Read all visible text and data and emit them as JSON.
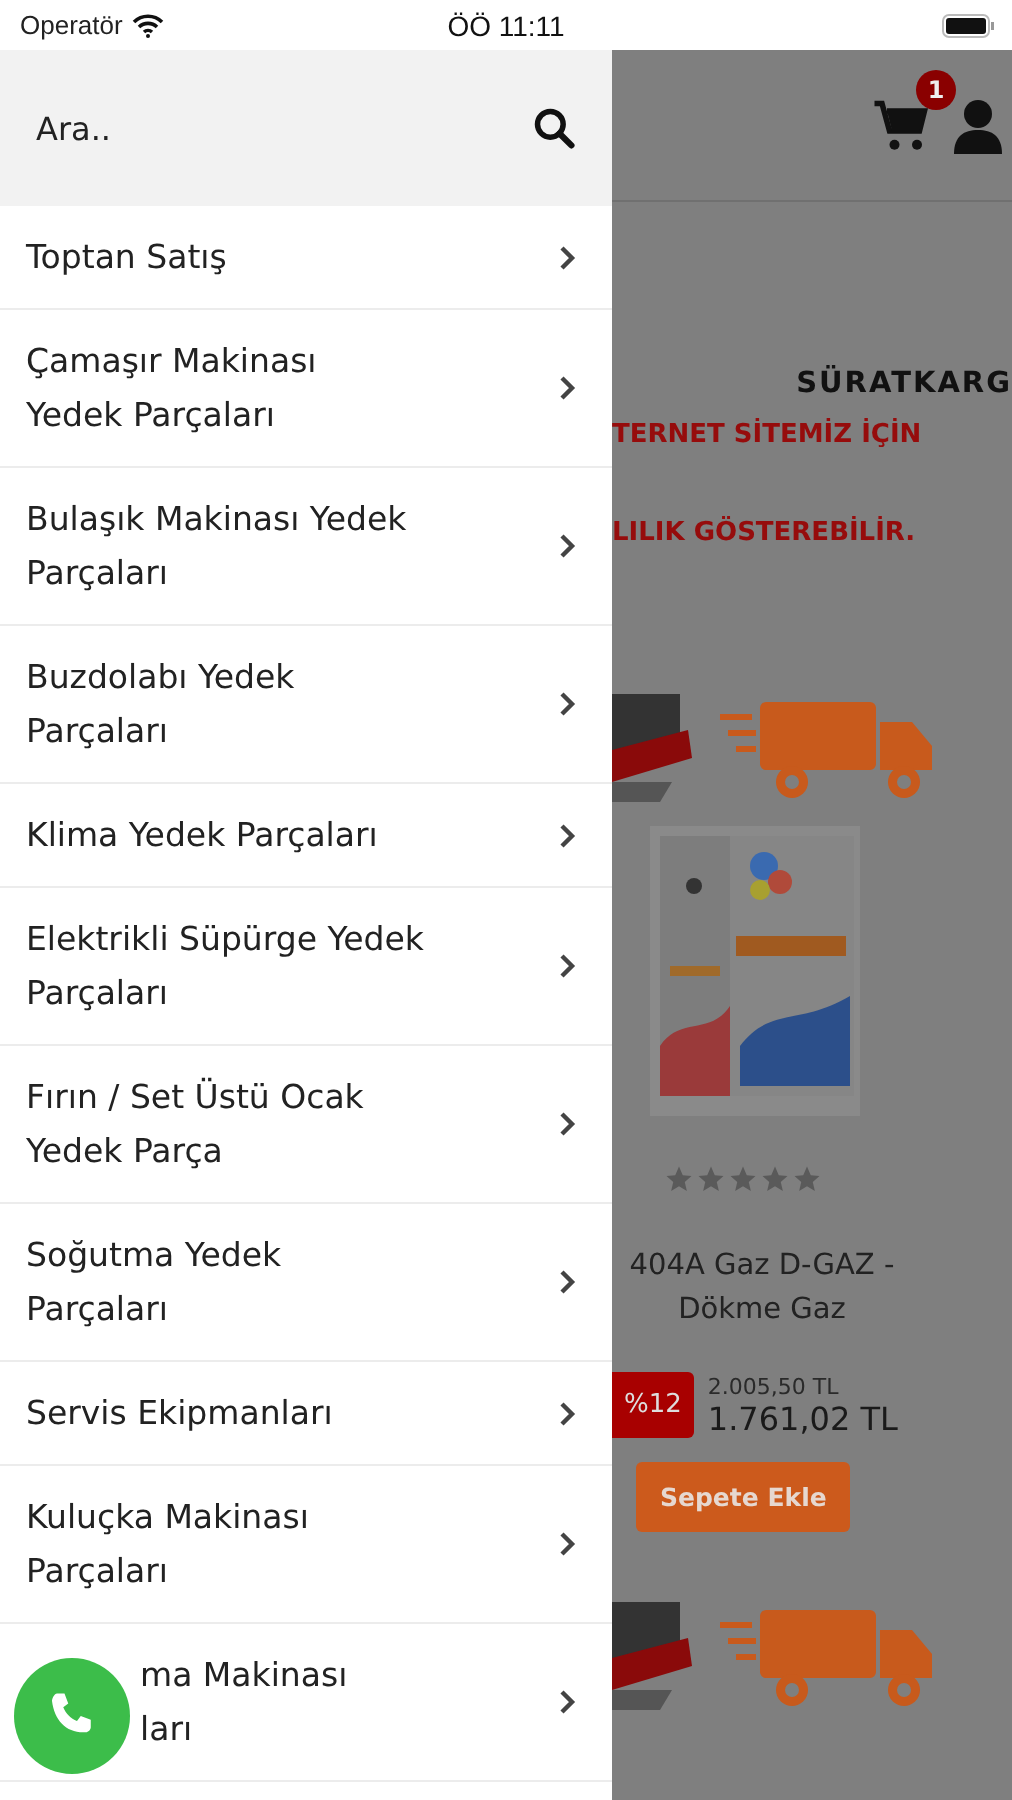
{
  "status_bar": {
    "carrier": "Operatör",
    "time": "ÖÖ 11:11"
  },
  "search": {
    "placeholder": "Ara.."
  },
  "menu": [
    {
      "label": "Toptan Satış"
    },
    {
      "label": "Çamaşır Makinası\nYedek Parçaları"
    },
    {
      "label": "Bulaşık Makinası Yedek\nParçaları"
    },
    {
      "label": "Buzdolabı Yedek\nParçaları"
    },
    {
      "label": "Klima Yedek Parçaları"
    },
    {
      "label": "Elektrikli Süpürge Yedek\nParçaları"
    },
    {
      "label": "Fırın / Set Üstü Ocak\nYedek Parça"
    },
    {
      "label": "Soğutma Yedek\nParçaları"
    },
    {
      "label": "Servis Ekipmanları"
    },
    {
      "label": "Kuluçka Makinası\nParçaları"
    },
    {
      "label": "ma Makinası\nları"
    }
  ],
  "page": {
    "cart_count": "1",
    "banner": {
      "title": "SÜRATKARG",
      "lines": [
        "TERNET SİTEMİZ İÇİN",
        "LILIK GÖSTEREBİLİR."
      ]
    },
    "product": {
      "stars": 0,
      "name": "404A Gaz D-GAZ -\nDökme Gaz",
      "discount": "%12",
      "old_price": "2.005,50 TL",
      "price": "1.761,02 TL",
      "button": "Sepete Ekle"
    }
  }
}
